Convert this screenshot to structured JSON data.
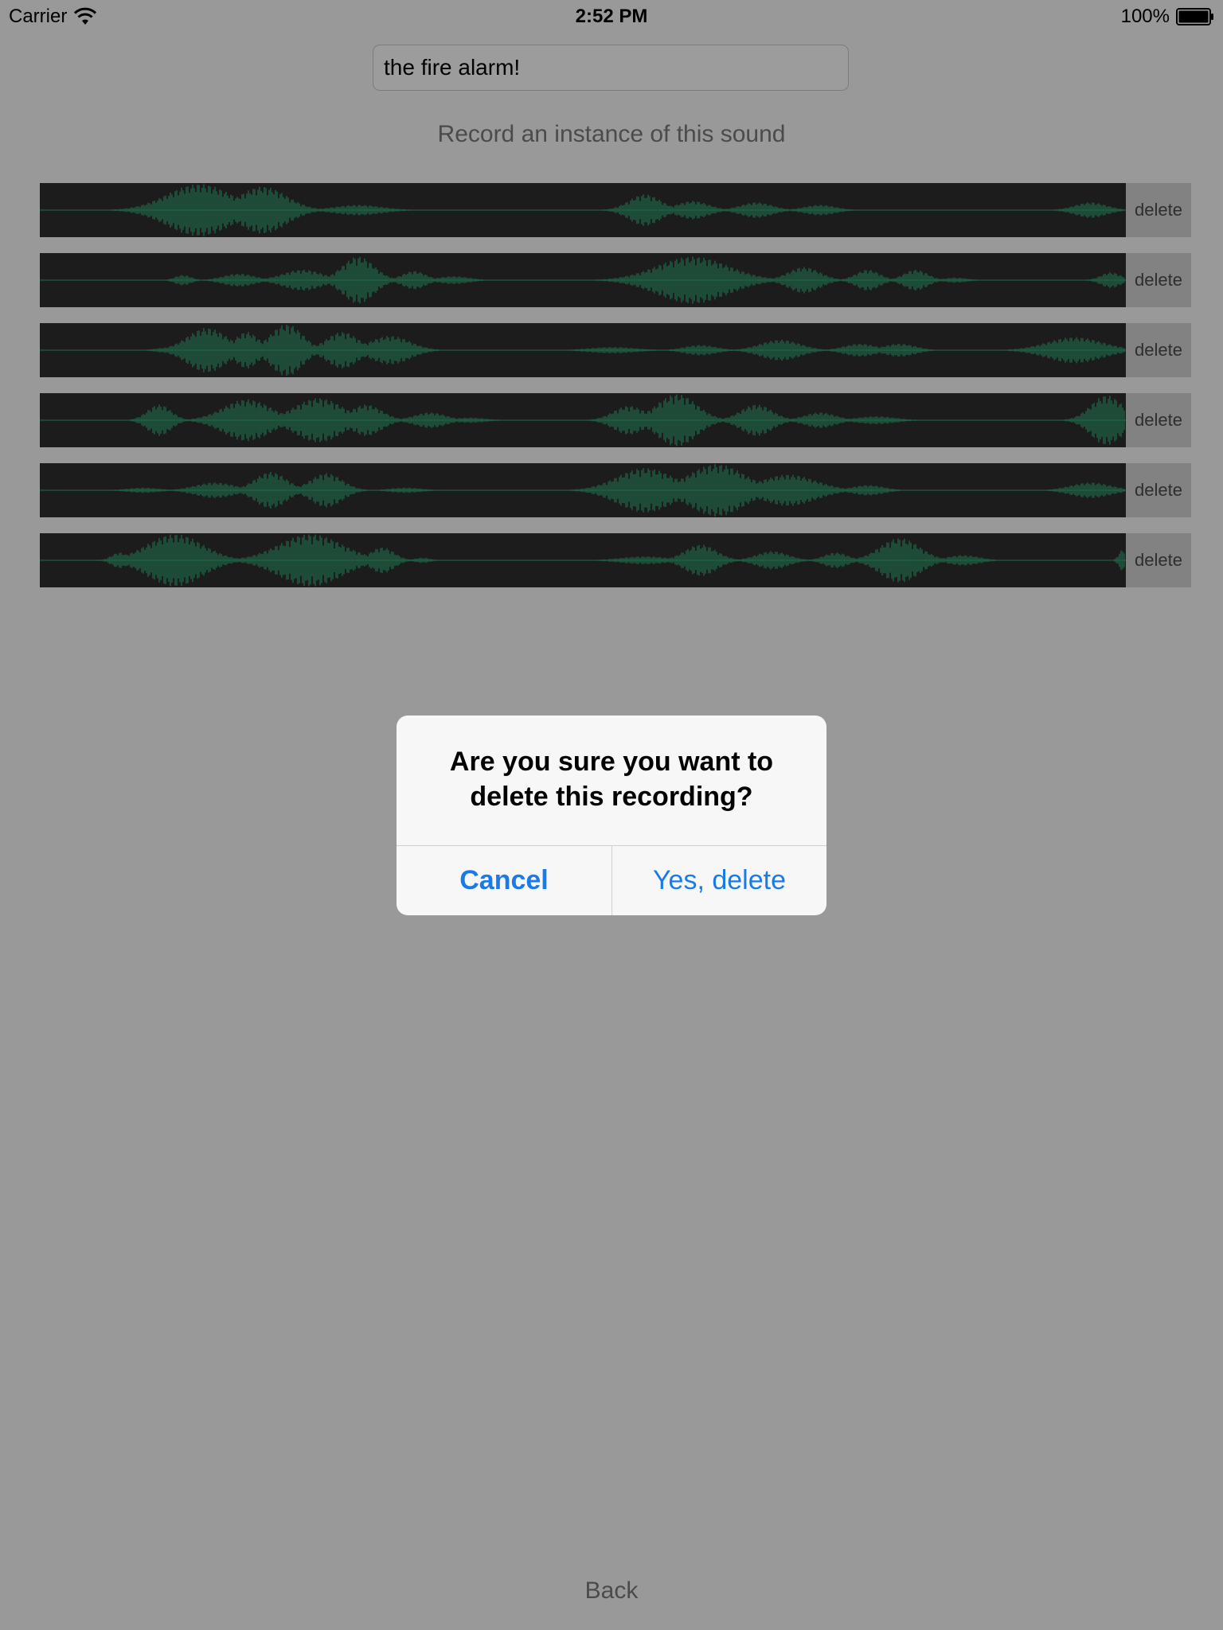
{
  "status_bar": {
    "carrier": "Carrier",
    "time": "2:52 PM",
    "battery": "100%",
    "wifi_icon": "wifi-icon",
    "battery_icon": "battery-icon"
  },
  "sound_name_field": {
    "value": "the fire alarm!"
  },
  "instructions": "Record an instance of this sound",
  "recordings": [
    {
      "delete_label": "delete"
    },
    {
      "delete_label": "delete"
    },
    {
      "delete_label": "delete"
    },
    {
      "delete_label": "delete"
    },
    {
      "delete_label": "delete"
    },
    {
      "delete_label": "delete"
    }
  ],
  "alert": {
    "message_line1": "Are you sure you want to",
    "message_line2": "delete this recording?",
    "cancel_label": "Cancel",
    "confirm_label": "Yes, delete"
  },
  "back_label": "Back",
  "colors": {
    "background": "#999999",
    "waveform_background": "#1c1c1c",
    "waveform_color": "#1e6b4a",
    "delete_background": "#828282",
    "alert_background": "#f7f7f7",
    "alert_button_color": "#1a7be8"
  }
}
